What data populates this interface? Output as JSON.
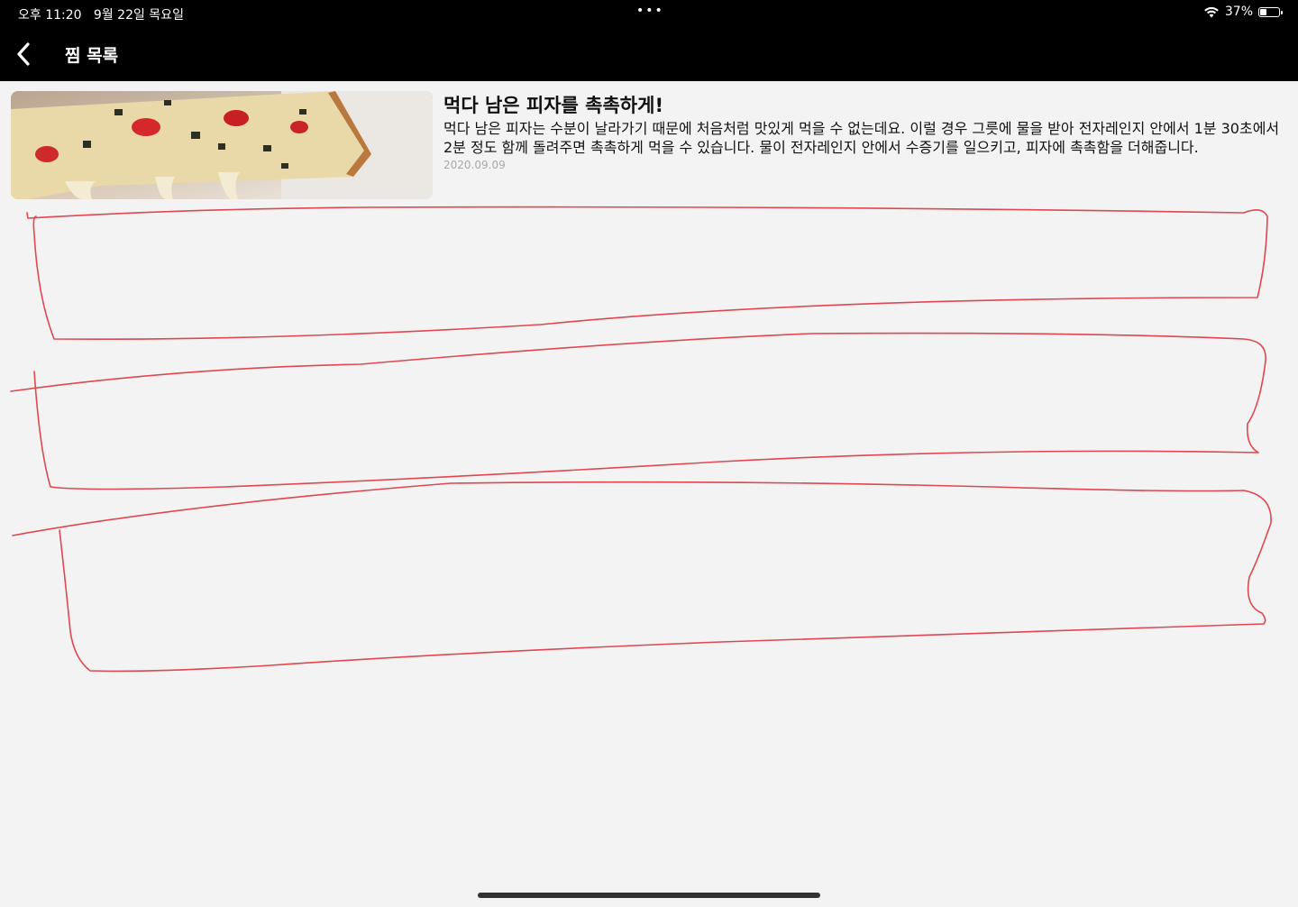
{
  "status_bar": {
    "time": "오후 11:20",
    "date": "9월 22일 목요일",
    "dots": "•••",
    "battery_percent": "37%",
    "battery_level": 0.37
  },
  "nav": {
    "title": "찜 목록",
    "back_icon": "chevron-left-icon"
  },
  "items": [
    {
      "title": "먹다 남은 피자를 촉촉하게!",
      "description": "먹다 남은 피자는 수분이 날라가기 때문에 처음처럼 맛있게 먹을 수 없는데요. 이럴 경우 그릇에 물을 받아 전자레인지 안에서 1분 30초에서 2분 정도 함께 돌려주면 촉촉하게 먹을 수 있습니다. 물이 전자레인지 안에서 수증기를 일으키고, 피자에 촉촉함을 더해줍니다.",
      "date": "2020.09.09",
      "image": "pizza-slice-photo"
    }
  ],
  "colors": {
    "bar_background": "#000000",
    "page_background": "#f3f3f3",
    "annotation_stroke": "#e0474f",
    "date_text": "#a9a9a9"
  }
}
